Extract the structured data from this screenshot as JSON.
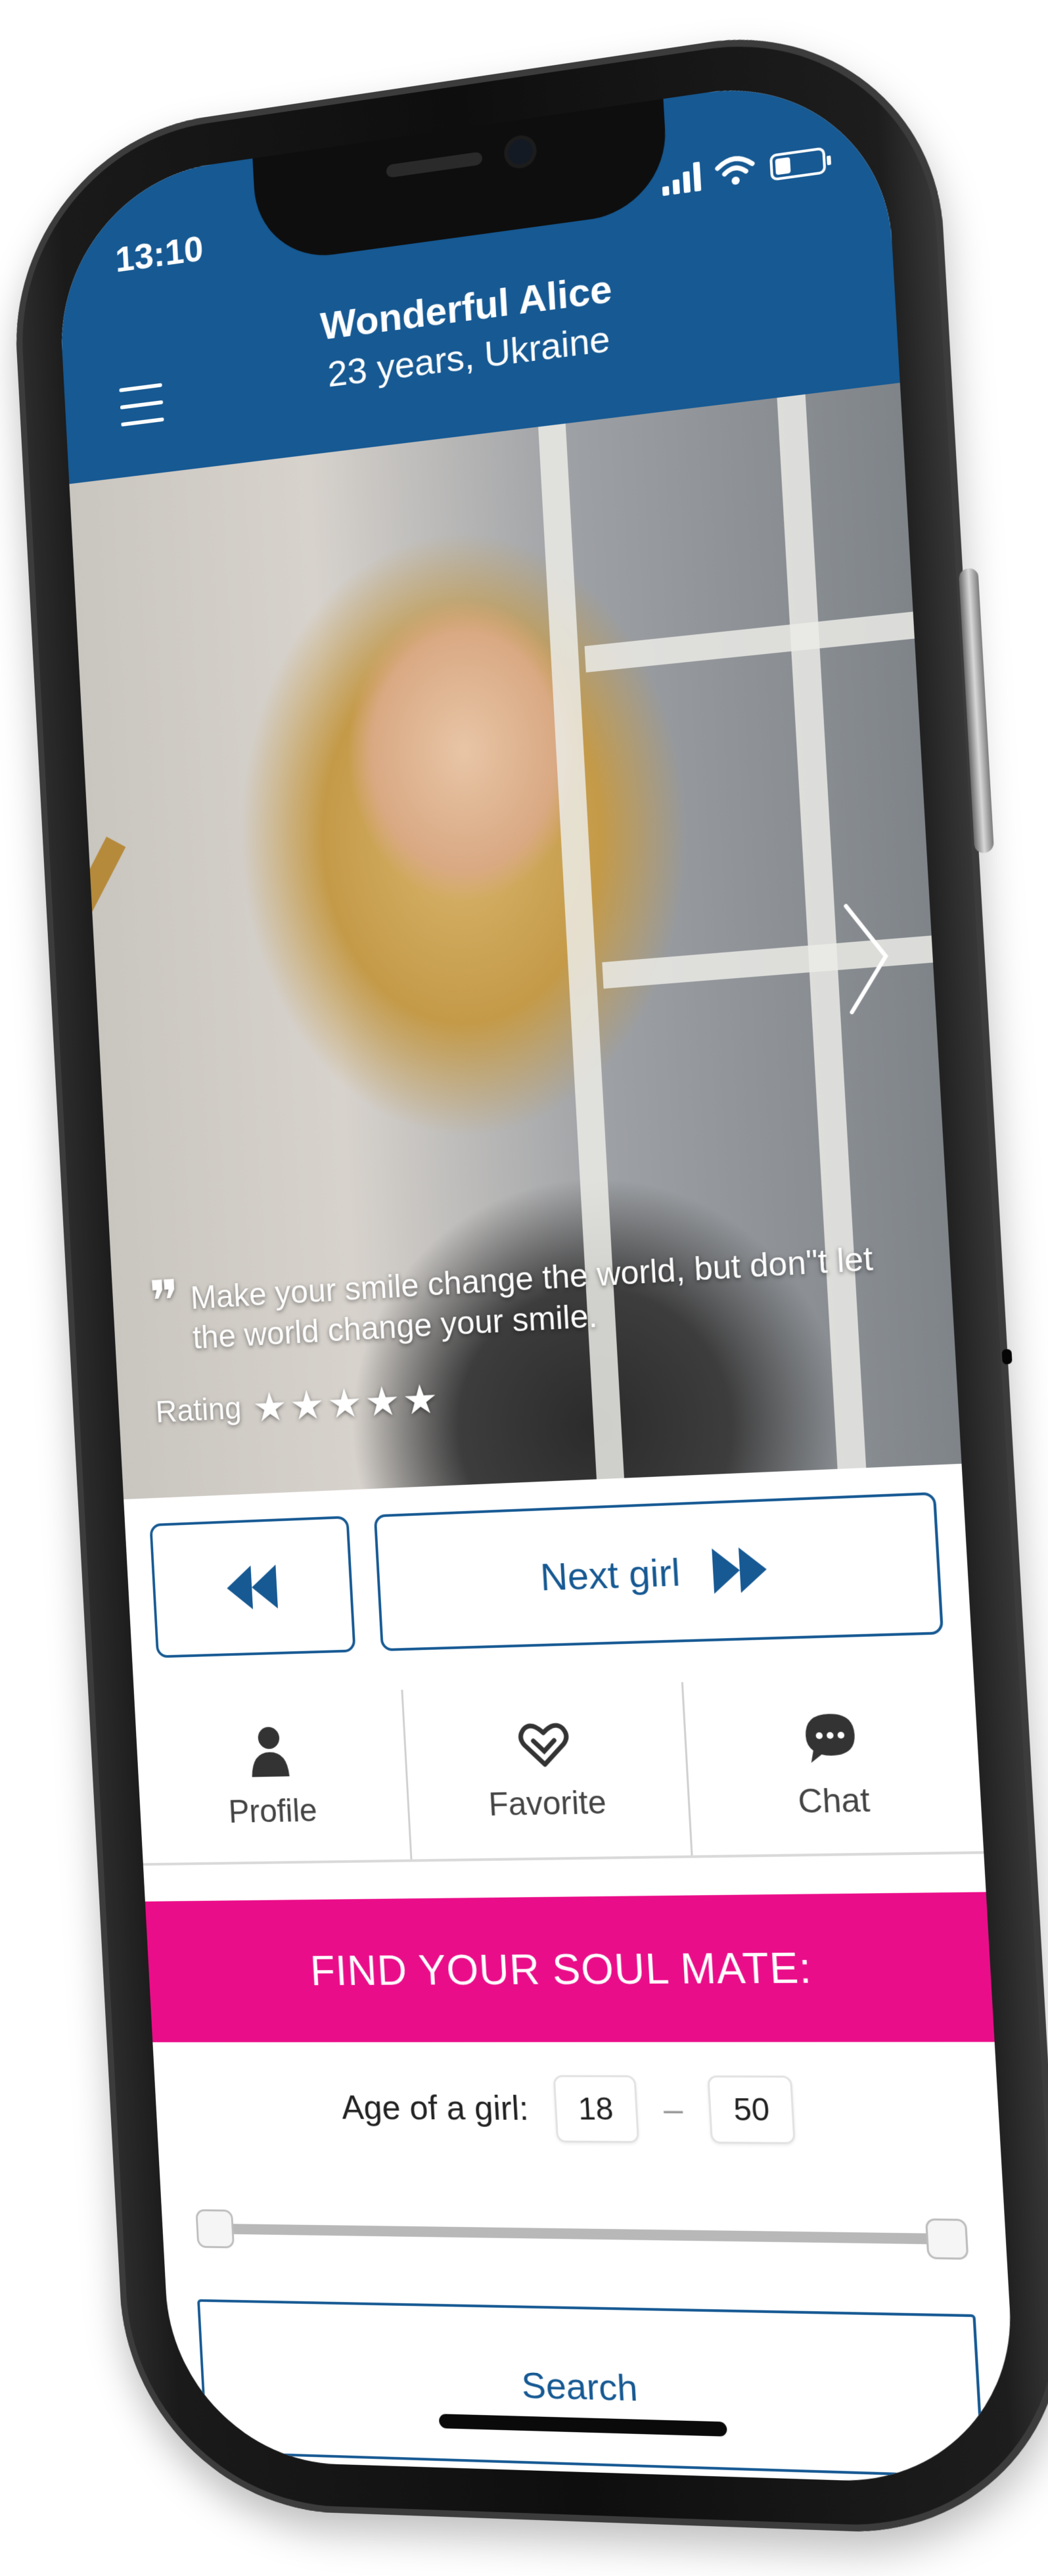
{
  "status_bar": {
    "time": "13:10"
  },
  "header": {
    "name": "Wonderful Alice",
    "details": "23 years, Ukraine"
  },
  "profile": {
    "quote": "Make your smile change the world, but don\"t let the world change your smile.",
    "rating_label": "Rating",
    "rating_stars": "★★★★★",
    "rating_value": 5
  },
  "navigation": {
    "next_label": "Next girl"
  },
  "actions": [
    {
      "label": "Profile",
      "icon": "person-icon"
    },
    {
      "label": "Favorite",
      "icon": "heart-icon"
    },
    {
      "label": "Chat",
      "icon": "chat-bubble-icon"
    }
  ],
  "search": {
    "banner": "FIND YOUR SOUL MATE:",
    "age_label": "Age of a girl:",
    "age_min": "18",
    "age_separator": "–",
    "age_max": "50",
    "button_label": "Search"
  },
  "colors": {
    "primary": "#165993",
    "accent": "#ea0d89"
  }
}
